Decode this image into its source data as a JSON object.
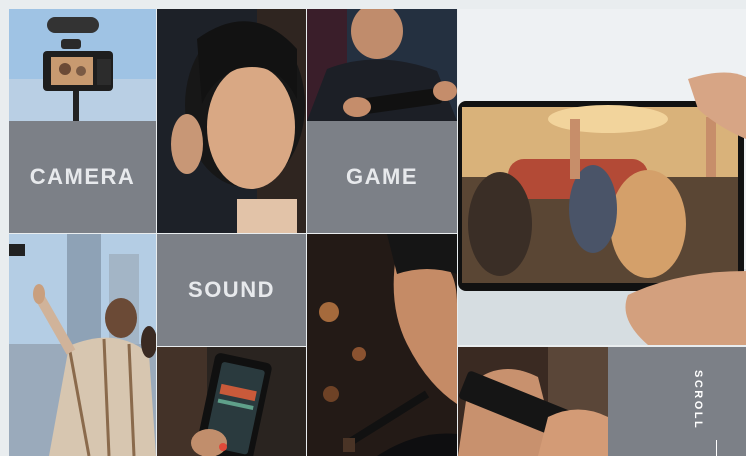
{
  "tiles": {
    "camera": "CAMERA",
    "game": "GAME",
    "sound": "SOUND"
  },
  "scroll": {
    "label": "SCROLL"
  },
  "colors": {
    "label_tile": "#7c8087",
    "label_text": "#e7e9ec",
    "background": "#e9edef"
  }
}
